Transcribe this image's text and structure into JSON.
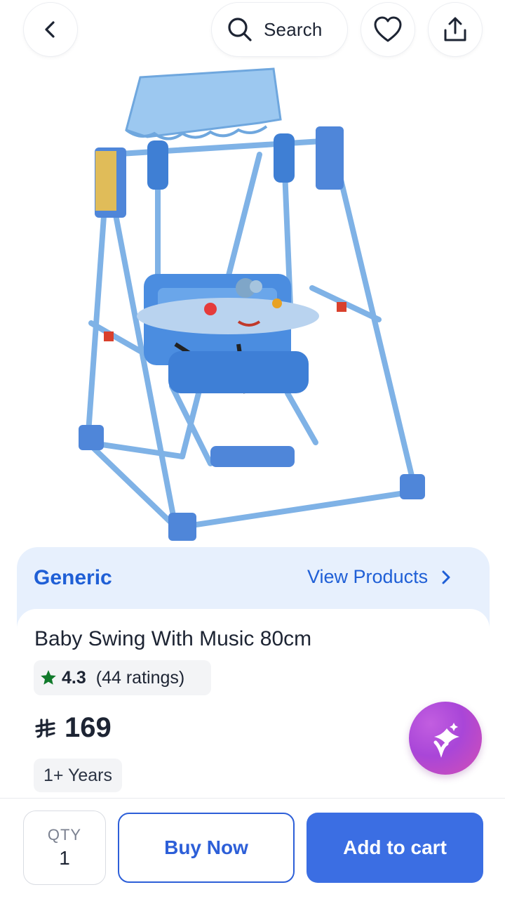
{
  "header": {
    "back_icon": "chevron-left-icon",
    "search_label": "Search",
    "search_icon": "search-icon",
    "favorite_icon": "heart-icon",
    "share_icon": "share-icon"
  },
  "hero": {
    "image": "baby-swing-product-photo"
  },
  "brand": {
    "name": "Generic",
    "view_products_label": "View Products"
  },
  "product": {
    "title": "Baby Swing With Music 80cm",
    "rating": "4.3",
    "ratings_count": "(44 ratings)",
    "currency_icon": "saudi-riyal-icon",
    "price": "169",
    "age": "1+ Years"
  },
  "assistant": {
    "icon": "ai-sparkle-icon"
  },
  "bottom_bar": {
    "qty_label": "QTY",
    "qty_value": "1",
    "buy_now_label": "Buy Now",
    "add_to_cart_label": "Add to cart"
  },
  "colors": {
    "brand_blue": "#1f5fd6",
    "cta_blue": "#3b6ee3",
    "band_bg": "#e7f0fd",
    "rating_star": "#117a2b"
  }
}
